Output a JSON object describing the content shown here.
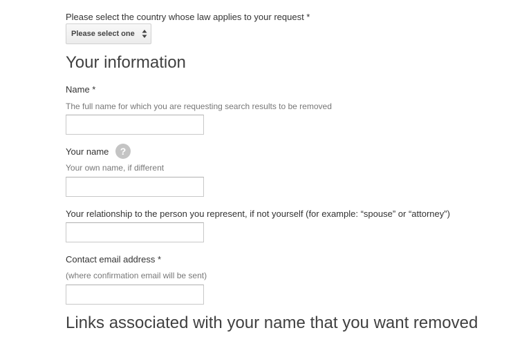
{
  "country": {
    "label": "Please select the country whose law applies to your request *",
    "select_value": "Please select one",
    "arrows_icon": "up-down-arrows-icon"
  },
  "your_information": {
    "title": "Your information",
    "name": {
      "label": "Name *",
      "hint": "The full name for which you are requesting search results to be removed",
      "value": ""
    },
    "your_name": {
      "label": "Your name",
      "help_icon_text": "?",
      "hint": "Your own name, if different",
      "value": ""
    },
    "relationship": {
      "label": "Your relationship to the person you represent, if not yourself (for example: “spouse” or “attorney”)",
      "value": ""
    },
    "email": {
      "label": "Contact email address *",
      "hint": "(where confirmation email will be sent)",
      "value": ""
    }
  },
  "links_section": {
    "title": "Links associated with your name that you want removed"
  },
  "colors": {
    "text": "#333333",
    "hint": "#777777",
    "input_border": "#c8c8c8",
    "help_icon": "#c4c4c4"
  }
}
